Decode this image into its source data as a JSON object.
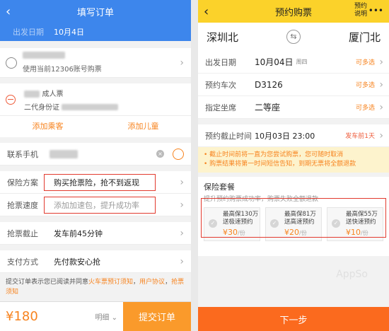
{
  "left": {
    "title": "填写订单",
    "back": "‹",
    "date_label": "出发日期",
    "date_value": "10月4日",
    "account_hint": "使用当前12306账号购票",
    "passenger_type": "成人票",
    "passenger_id_type": "二代身份证",
    "add_passenger": "添加乘客",
    "add_child": "添加儿童",
    "phone_label": "联系手机",
    "insurance_label": "保险方案",
    "insurance_value": "购买抢票险，抢不到返现",
    "speed_label": "抢票速度",
    "speed_placeholder": "添加加速包，提升成功率",
    "deadline_label": "抢票截止",
    "deadline_value": "发车前45分钟",
    "pay_label": "支付方式",
    "pay_value": "先付款安心抢",
    "note_prefix": "提交订单表示您已阅读并同意",
    "note_link1": "火车票预订须知",
    "note_sep": "，",
    "note_link2": "用户协议",
    "note_link3": "抢票须知",
    "price": "¥180",
    "detail": "明细 ⌄",
    "submit": "提交订单"
  },
  "right": {
    "title": "预约购票",
    "back": "‹",
    "explain": "预约说明",
    "more": "•••",
    "from": "深圳北",
    "to": "厦门北",
    "swap_icon": "⇆",
    "date_label": "出发日期",
    "date_value": "10月04日",
    "weekday": "周四",
    "date_opt": "可多选",
    "train_label": "预约车次",
    "train_value": "D3126",
    "train_opt": "可多选",
    "seat_label": "指定坐席",
    "seat_value": "二等座",
    "seat_opt": "可多选",
    "deadline_label": "预约截止时间",
    "deadline_value": "10月03日 23:00",
    "deadline_opt": "发车前1天",
    "note1": "• 截止时间前将一直为您尝试购票，您可随时取消",
    "note2": "• 购票结果将第一时间短信告知，到期无票将全额退款",
    "ins_title": "保险套餐",
    "ins_sub": "提升预约购票成功率，购票失败全额退款",
    "cards": [
      {
        "l1": "最高保130万",
        "l2": "送极速预约",
        "price": "¥30",
        "unit": "/份"
      },
      {
        "l1": "最高保81万",
        "l2": "送高速预约",
        "price": "¥20",
        "unit": "/份"
      },
      {
        "l1": "最高保55万",
        "l2": "送快速预约",
        "price": "¥10",
        "unit": "/份"
      }
    ],
    "watermark": "AppSo",
    "next": "下一步"
  }
}
